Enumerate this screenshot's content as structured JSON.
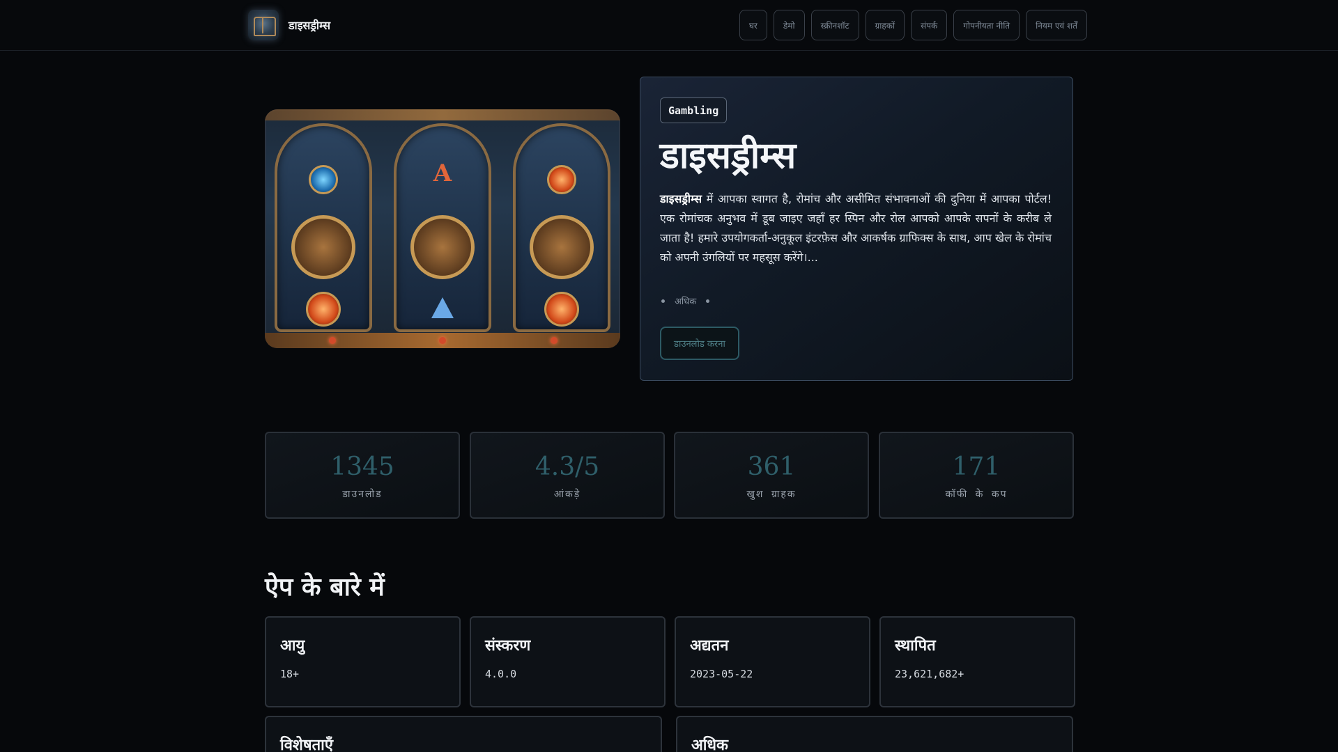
{
  "header": {
    "brand_name": "डाइसड्रीम्स",
    "nav": [
      "घर",
      "डेमो",
      "स्क्रीनशॉट",
      "ग्राहकों",
      "संपर्क",
      "गोपनीयता नीति",
      "नियम एवं शर्तें"
    ]
  },
  "hero": {
    "tag": "Gambling",
    "title": "डाइसड्रीम्स",
    "desc_bold": "डाइसड्रीम्स",
    "desc_rest": " में आपका स्वागत है, रोमांच और असीमित संभावनाओं की दुनिया में आपका पोर्टल! एक रोमांचक अनुभव में डूब जाइए जहाँ हर स्पिन और रोल आपको आपके सपनों के करीब ले जाता है! हमारे उपयोगकर्ता-अनुकूल इंटरफ़ेस और आकर्षक ग्राफिक्स के साथ, आप खेल के रोमांच को अपनी उंगलियों पर महसूस करेंगे।...",
    "more_label": "अधिक",
    "download_label": "डाउनलोड करना",
    "image_icon": "slot-machine-image"
  },
  "stats": [
    {
      "value": "1345",
      "label": "डाउनलोड"
    },
    {
      "value": "4.3/5",
      "label": "आंकड़े"
    },
    {
      "value": "361",
      "label": "खुश ग्राहक"
    },
    {
      "value": "171",
      "label": "कॉफी के कप"
    }
  ],
  "about": {
    "title": "ऐप के बारे में",
    "cards": [
      {
        "title": "आयु",
        "value": "18+"
      },
      {
        "title": "संस्करण",
        "value": "4.0.0"
      },
      {
        "title": "अद्यतन",
        "value": "2023-05-22"
      },
      {
        "title": "स्थापित",
        "value": "23,621,682+"
      }
    ],
    "wide_cards": [
      {
        "title": "विशेषताएँ"
      },
      {
        "title": "अधिक"
      }
    ]
  },
  "colors": {
    "background": "#06080b",
    "accent_teal": "#2f5f6a",
    "card_border": "#3a4a5e"
  }
}
